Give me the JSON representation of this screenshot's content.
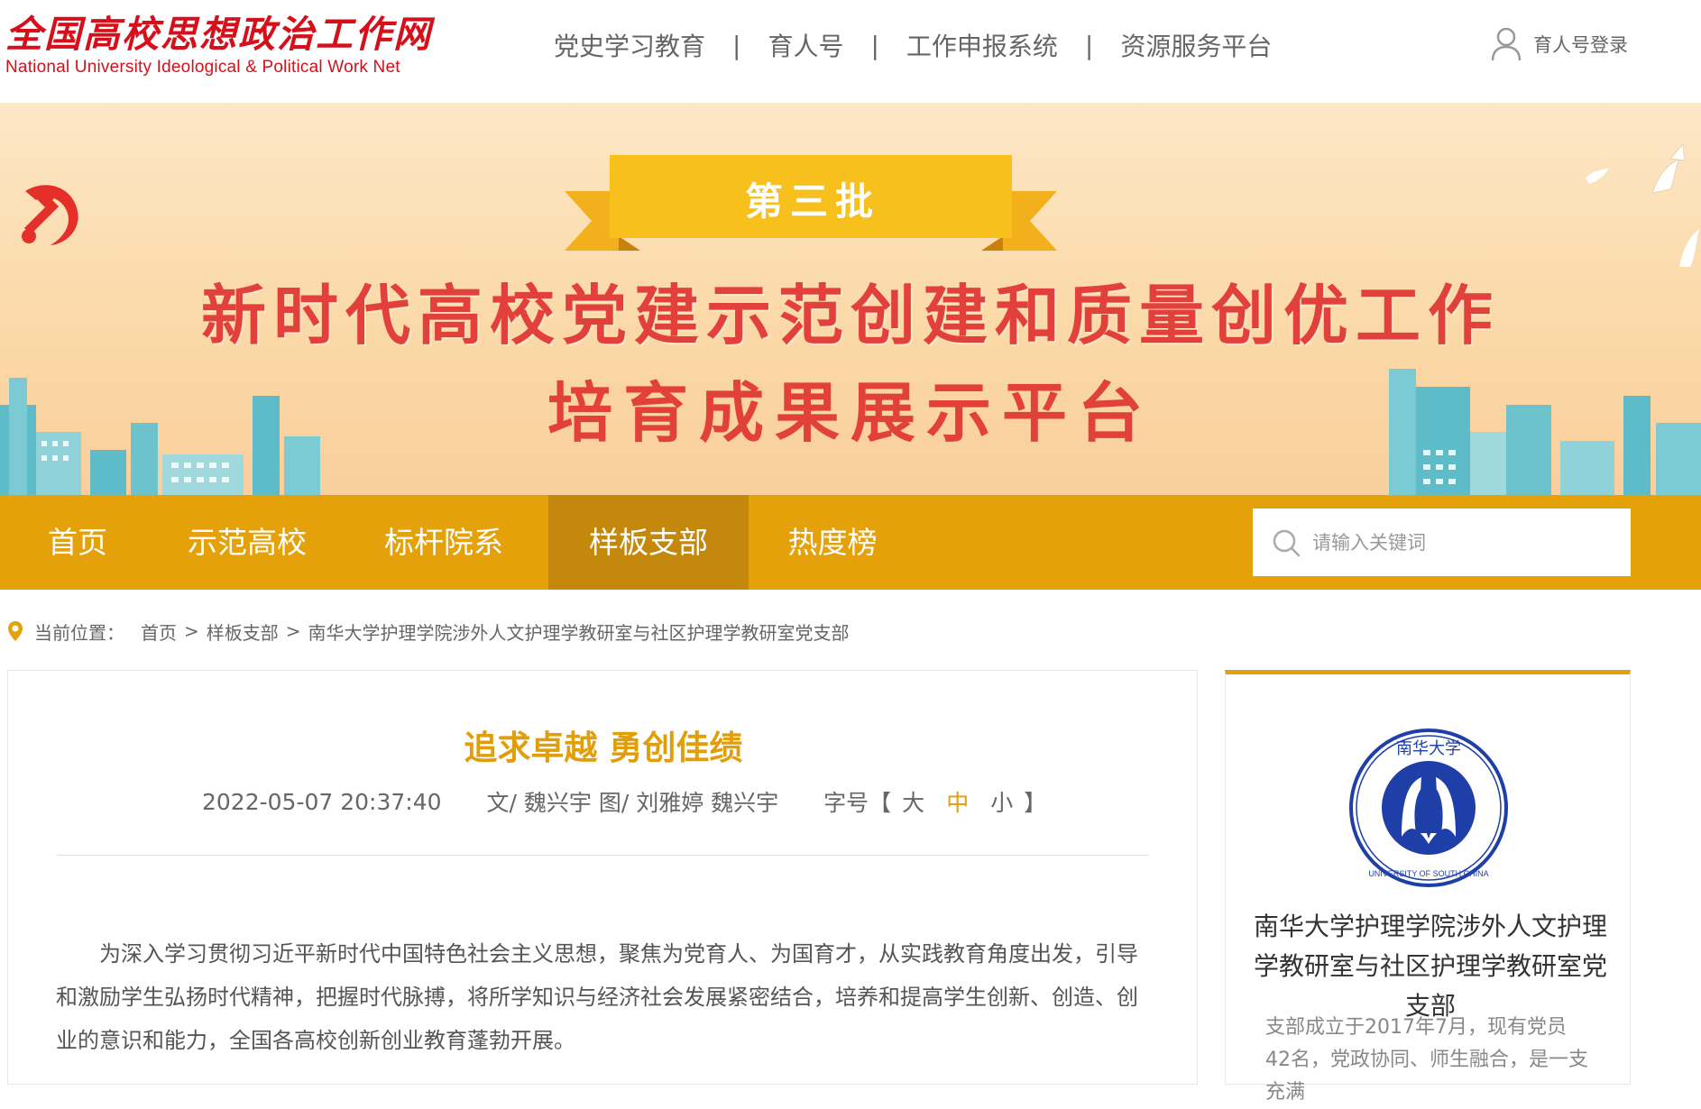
{
  "header": {
    "logo_cn": "全国高校思想政治工作网",
    "logo_en": "National University Ideological & Political Work Net",
    "nav": [
      "党史学习教育",
      "育人号",
      "工作申报系统",
      "资源服务平台"
    ],
    "separator": "|",
    "login_label": "育人号登录",
    "login_icon": "user-icon"
  },
  "banner": {
    "ribbon": "第三批",
    "title_line1": "新时代高校党建示范创建和质量创优工作",
    "title_line2": "培育成果展示平台"
  },
  "mainnav": {
    "items": [
      "首页",
      "示范高校",
      "标杆院系",
      "样板支部",
      "热度榜"
    ],
    "active_index": 3,
    "search_placeholder": "请输入关键词",
    "search_icon": "search-icon"
  },
  "breadcrumb": {
    "label": "当前位置：",
    "items": [
      "首页",
      "样板支部",
      "南华大学护理学院涉外人文护理学教研室与社区护理学教研室党支部"
    ],
    "arrow": ">",
    "icon": "location-pin-icon"
  },
  "article": {
    "title": "追求卓越 勇创佳绩",
    "date": "2022-05-07 20:37:40",
    "author": "文/ 魏兴宇 图/ 刘雅婷 魏兴宇",
    "font_label": "字号【",
    "font_close": "】",
    "font_sizes": [
      "大",
      "中",
      "小"
    ],
    "font_active_index": 1,
    "body": "为深入学习贯彻习近平新时代中国特色社会主义思想，聚焦为党育人、为国育才，从实践教育角度出发，引导和激励学生弘扬时代精神，把握时代脉搏，将所学知识与经济社会发展紧密结合，培养和提高学生创新、创造、创业的意识和能力，全国各高校创新创业教育蓬勃开展。"
  },
  "sidebar": {
    "logo_text": "UNIVERSITY OF SOUTH CHINA",
    "logo_cn": "南华大学",
    "title": "南华大学护理学院涉外人文护理学教研室与社区护理学教研室党支部",
    "description": "支部成立于2017年7月，现有党员42名，党政协同、师生融合，是一支充满"
  },
  "colors": {
    "brand_red": "#d6101b",
    "nav_orange": "#e5a109",
    "nav_active": "#c4880d",
    "title_orange": "#e09e0b",
    "banner_red": "#e2403b"
  }
}
